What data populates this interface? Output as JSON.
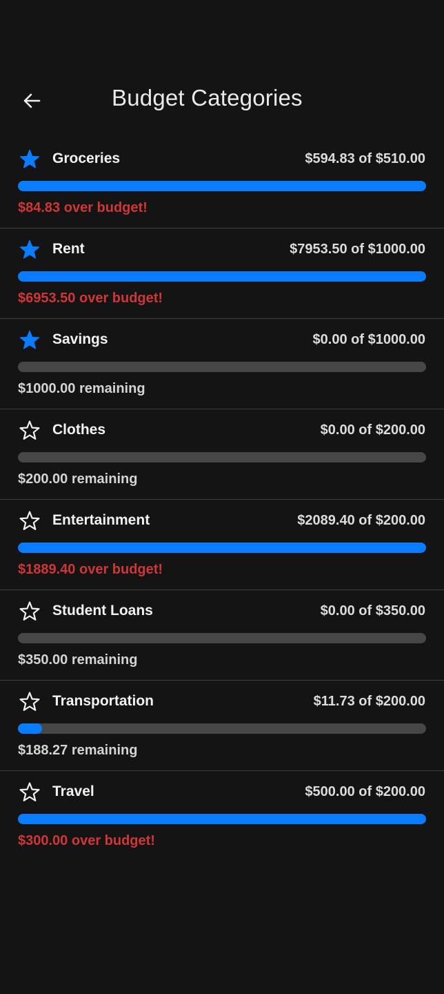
{
  "header": {
    "title": "Budget Categories",
    "back_icon": "arrow-left-icon"
  },
  "colors": {
    "background": "#141414",
    "accent": "#0a7cff",
    "track": "#474747",
    "over": "#d13636",
    "remaining": "#d4d4d4"
  },
  "categories": [
    {
      "name": "Groceries",
      "amount": "$594.83 of $510.00",
      "progress": 1.0,
      "starred": true,
      "status": "$84.83 over budget!",
      "over": true
    },
    {
      "name": "Rent",
      "amount": "$7953.50 of $1000.00",
      "progress": 1.0,
      "starred": true,
      "status": "$6953.50 over budget!",
      "over": true
    },
    {
      "name": "Savings",
      "amount": "$0.00 of $1000.00",
      "progress": 0.0,
      "starred": true,
      "status": "$1000.00 remaining",
      "over": false
    },
    {
      "name": "Clothes",
      "amount": "$0.00 of $200.00",
      "progress": 0.0,
      "starred": false,
      "status": "$200.00 remaining",
      "over": false
    },
    {
      "name": "Entertainment",
      "amount": "$2089.40 of $200.00",
      "progress": 1.0,
      "starred": false,
      "status": "$1889.40 over budget!",
      "over": true
    },
    {
      "name": "Student Loans",
      "amount": "$0.00 of $350.00",
      "progress": 0.0,
      "starred": false,
      "status": "$350.00 remaining",
      "over": false
    },
    {
      "name": "Transportation",
      "amount": "$11.73 of $200.00",
      "progress": 0.0587,
      "starred": false,
      "status": "$188.27 remaining",
      "over": false
    },
    {
      "name": "Travel",
      "amount": "$500.00 of $200.00",
      "progress": 1.0,
      "starred": false,
      "status": "$300.00 over budget!",
      "over": true
    }
  ]
}
